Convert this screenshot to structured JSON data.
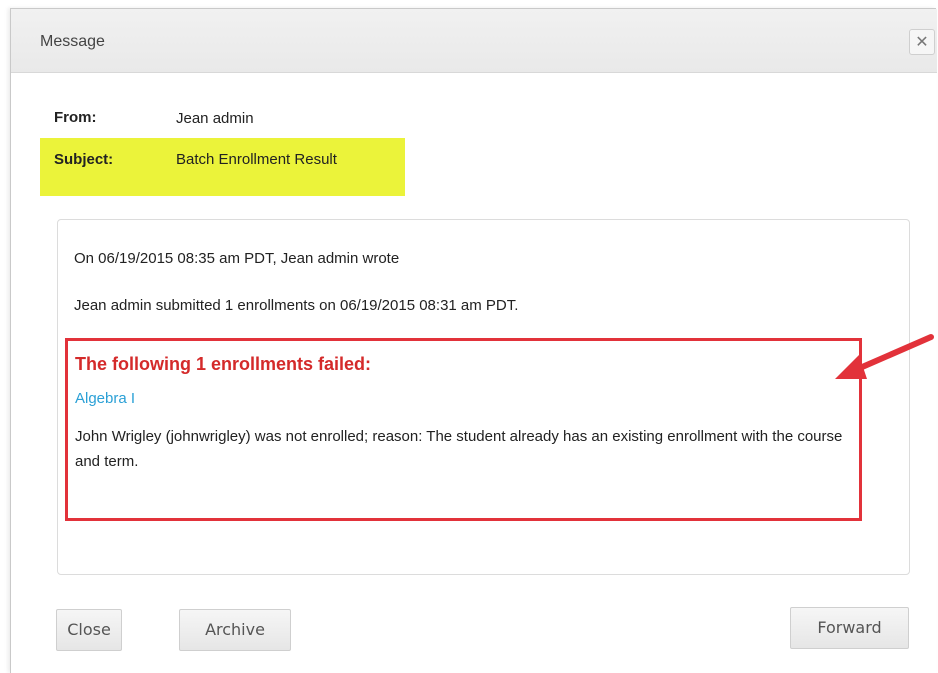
{
  "dialog": {
    "title": "Message",
    "close_icon": "close-x-icon",
    "close_glyph": "✕"
  },
  "header": {
    "from_label": "From:",
    "from_value": "Jean admin",
    "subject_label": "Subject:",
    "subject_value": "Batch Enrollment Result",
    "highlight_color": "#ebf33a"
  },
  "message": {
    "intro": "On 06/19/2015 08:35 am PDT, Jean admin wrote",
    "summary": "Jean admin submitted 1 enrollments on 06/19/2015 08:31 am PDT.",
    "failure": {
      "title": "The following 1 enrollments failed:",
      "course": "Algebra I",
      "reason": "John Wrigley (johnwrigley) was not enrolled; reason: The student already has an existing enrollment with the course and term.",
      "annotation_color": "#e2323a",
      "link_color": "#2aa0d6"
    }
  },
  "buttons": {
    "close": "Close",
    "archive": "Archive",
    "forward": "Forward"
  }
}
